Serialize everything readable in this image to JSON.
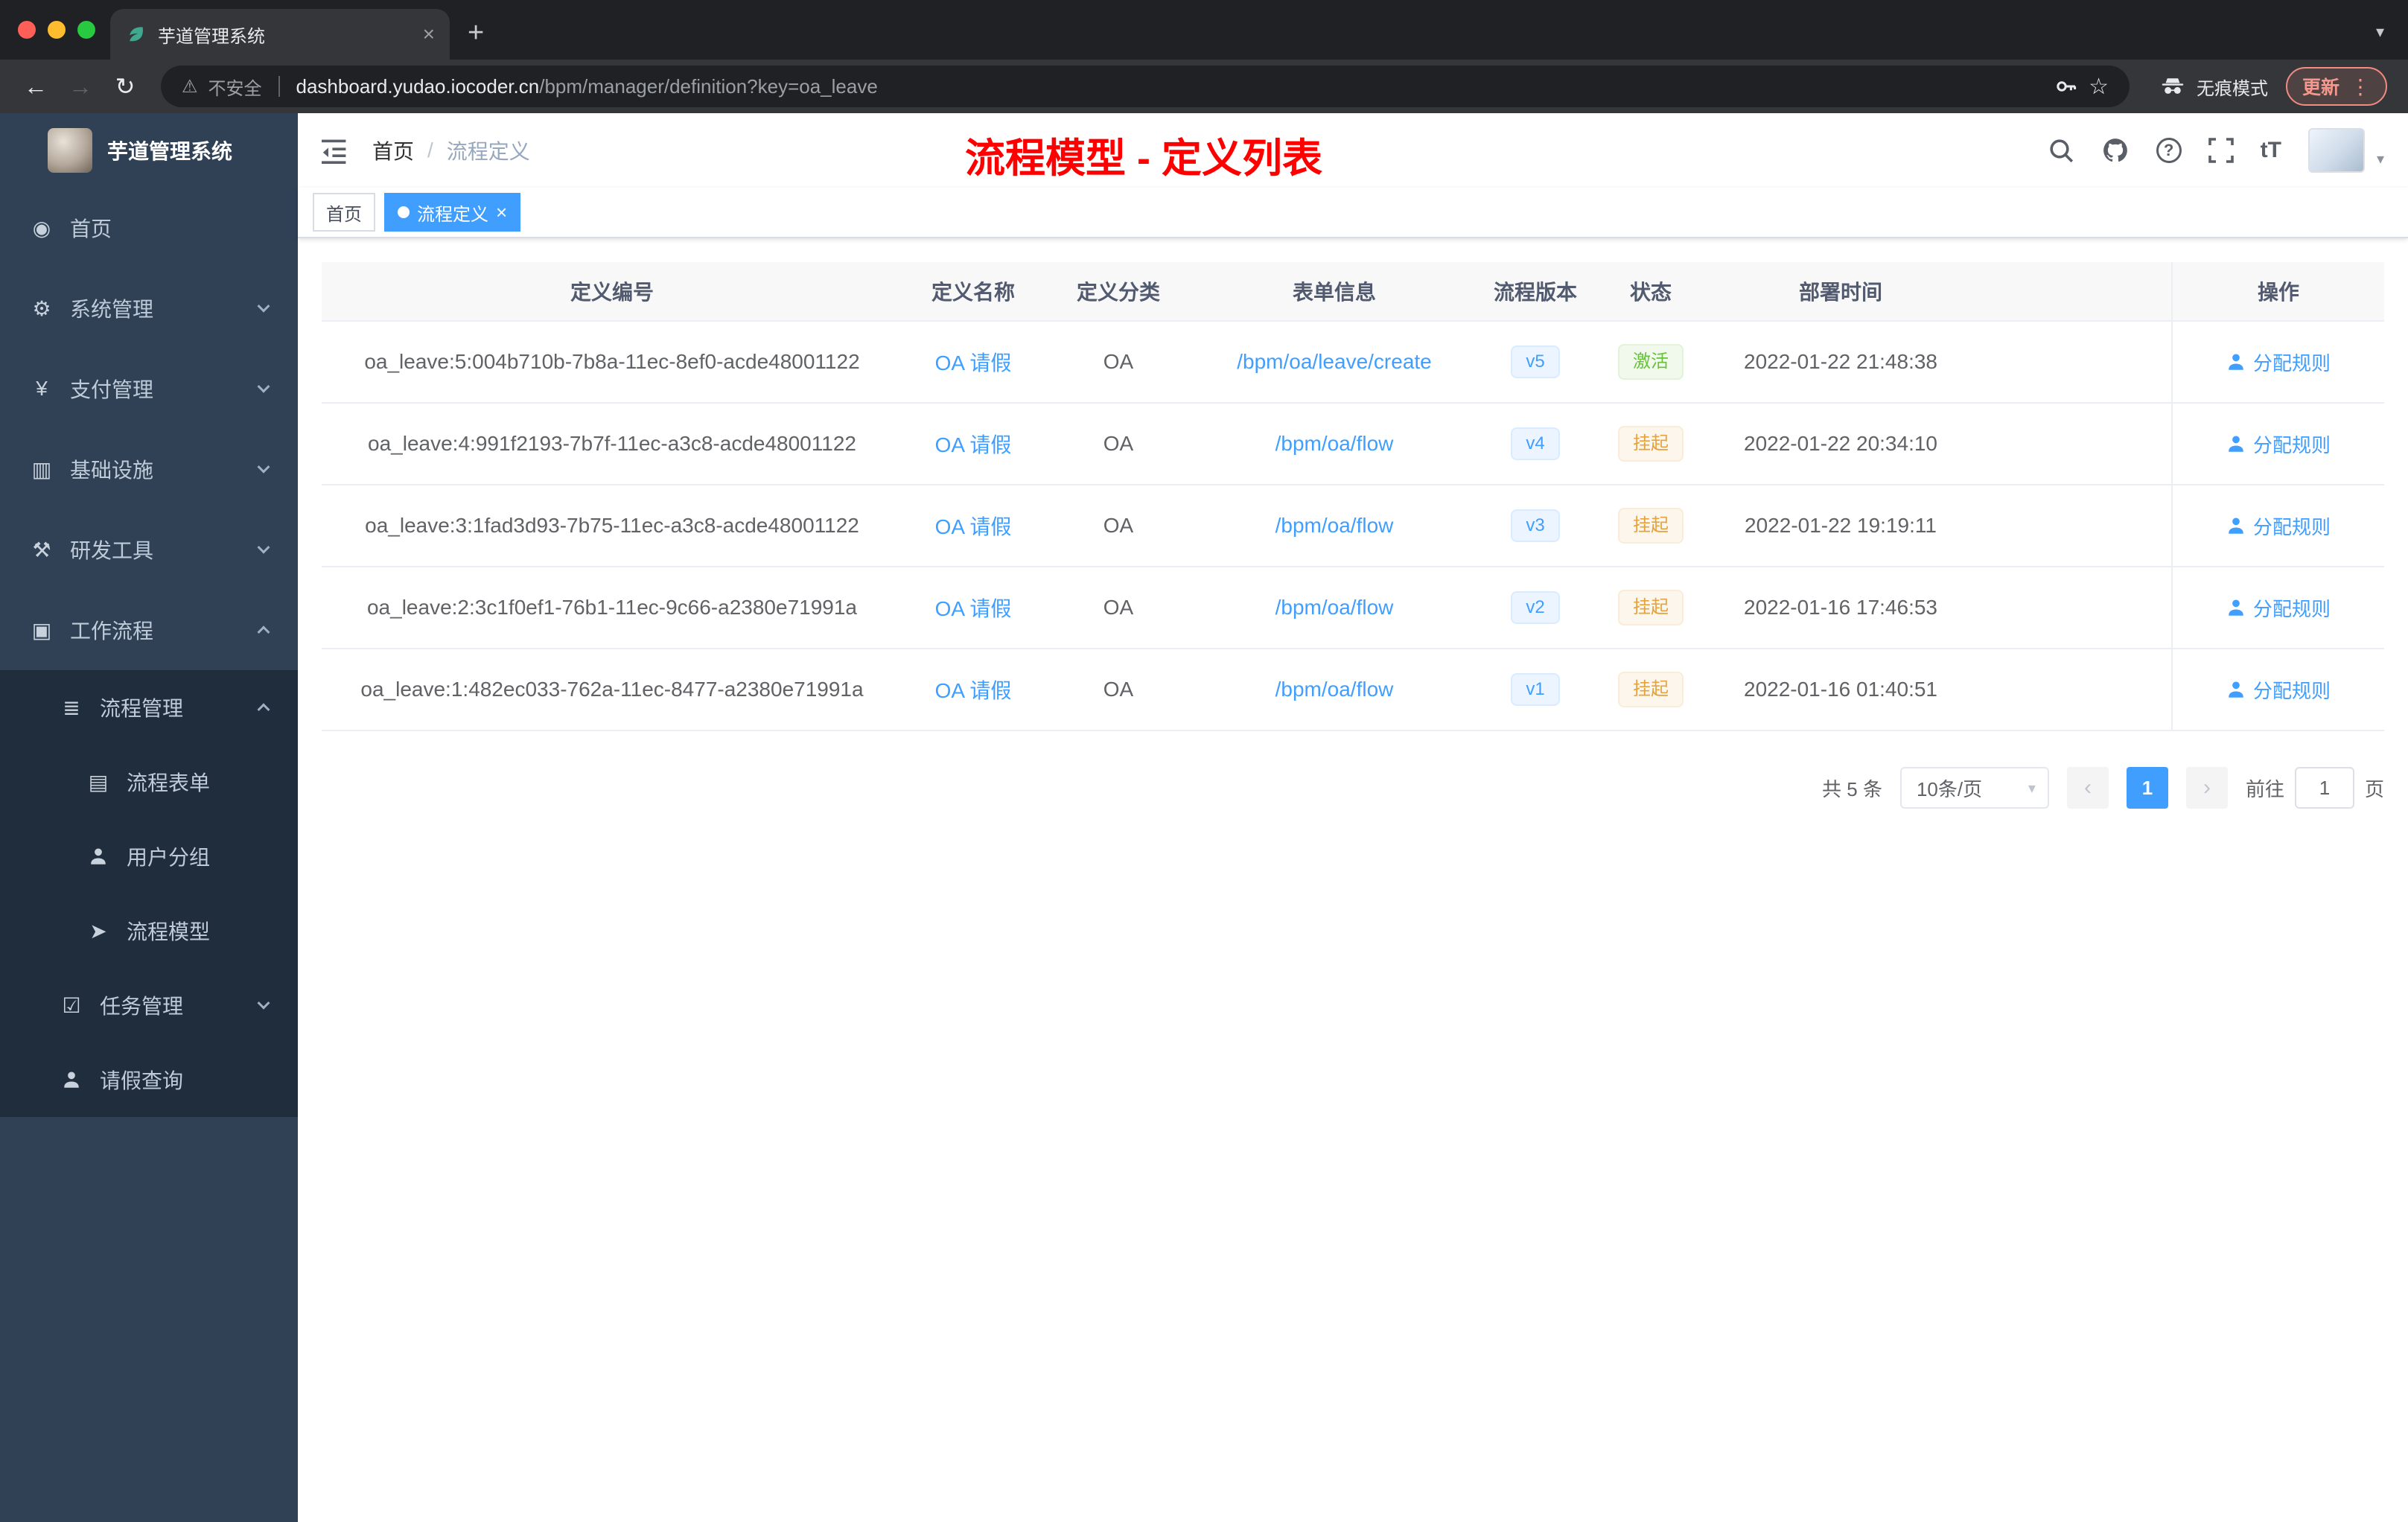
{
  "theme": {
    "accent": "#409eff",
    "success": "#67c23a",
    "warning": "#e6a23c",
    "annotation-red": "#ff0000",
    "sidebar-bg": "#304156",
    "sidebar-sub-bg": "#1f2d3d"
  },
  "browser": {
    "tab_title": "芋道管理系统",
    "security_label": "不安全",
    "url_domain": "dashboard.yudao.iocoder.cn",
    "url_path": "/bpm/manager/definition?key=oa_leave",
    "incognito_label": "无痕模式",
    "update_label": "更新"
  },
  "glyphs": {
    "close": "×",
    "new_tab": "+",
    "caret_down": "▾",
    "back": "←",
    "forward": "→",
    "reload": "↻",
    "warning": "⚠",
    "star": "☆",
    "more": "⋮",
    "question": "?",
    "text_size": "tT"
  },
  "sidebar": {
    "logo_title": "芋道管理系统",
    "items": [
      {
        "label": "首页",
        "glyph": "◉"
      },
      {
        "label": "系统管理",
        "glyph": "⚙"
      },
      {
        "label": "支付管理",
        "glyph": "¥"
      },
      {
        "label": "基础设施",
        "glyph": "▥"
      },
      {
        "label": "研发工具",
        "glyph": "⚒"
      },
      {
        "label": "工作流程",
        "glyph": "▣"
      },
      {
        "label": "流程管理",
        "glyph": "≣"
      },
      {
        "label": "流程表单",
        "glyph": "▤"
      },
      {
        "label": "用户分组",
        "glyph": ""
      },
      {
        "label": "流程模型",
        "glyph": "➤"
      },
      {
        "label": "任务管理",
        "glyph": "☑"
      },
      {
        "label": "请假查询",
        "glyph": ""
      }
    ]
  },
  "navbar": {
    "breadcrumb": [
      "首页",
      "流程定义"
    ],
    "separator": "/",
    "annotation": "流程模型 - 定义列表"
  },
  "tags": [
    {
      "label": "首页"
    },
    {
      "label": "流程定义"
    }
  ],
  "table": {
    "columns": [
      "定义编号",
      "定义名称",
      "定义分类",
      "表单信息",
      "流程版本",
      "状态",
      "部署时间",
      "操作"
    ],
    "rows": [
      {
        "id": "oa_leave:5:004b710b-7b8a-11ec-8ef0-acde48001122",
        "name": "OA 请假",
        "category": "OA",
        "form": "/bpm/oa/leave/create",
        "version": "v5",
        "status": "激活",
        "status_type": "active",
        "deploy_time": "2022-01-22 21:48:38",
        "action": "分配规则"
      },
      {
        "id": "oa_leave:4:991f2193-7b7f-11ec-a3c8-acde48001122",
        "name": "OA 请假",
        "category": "OA",
        "form": "/bpm/oa/flow",
        "version": "v4",
        "status": "挂起",
        "status_type": "suspend",
        "deploy_time": "2022-01-22 20:34:10",
        "action": "分配规则"
      },
      {
        "id": "oa_leave:3:1fad3d93-7b75-11ec-a3c8-acde48001122",
        "name": "OA 请假",
        "category": "OA",
        "form": "/bpm/oa/flow",
        "version": "v3",
        "status": "挂起",
        "status_type": "suspend",
        "deploy_time": "2022-01-22 19:19:11",
        "action": "分配规则"
      },
      {
        "id": "oa_leave:2:3c1f0ef1-76b1-11ec-9c66-a2380e71991a",
        "name": "OA 请假",
        "category": "OA",
        "form": "/bpm/oa/flow",
        "version": "v2",
        "status": "挂起",
        "status_type": "suspend",
        "deploy_time": "2022-01-16 17:46:53",
        "action": "分配规则"
      },
      {
        "id": "oa_leave:1:482ec033-762a-11ec-8477-a2380e71991a",
        "name": "OA 请假",
        "category": "OA",
        "form": "/bpm/oa/flow",
        "version": "v1",
        "status": "挂起",
        "status_type": "suspend",
        "deploy_time": "2022-01-16 01:40:51",
        "action": "分配规则"
      }
    ]
  },
  "pagination": {
    "total": "共 5 条",
    "page_size": "10条/页",
    "current_page": "1",
    "prev": "‹",
    "next": "›",
    "goto_label": "前往",
    "goto_value": "1",
    "page_unit": "页"
  }
}
